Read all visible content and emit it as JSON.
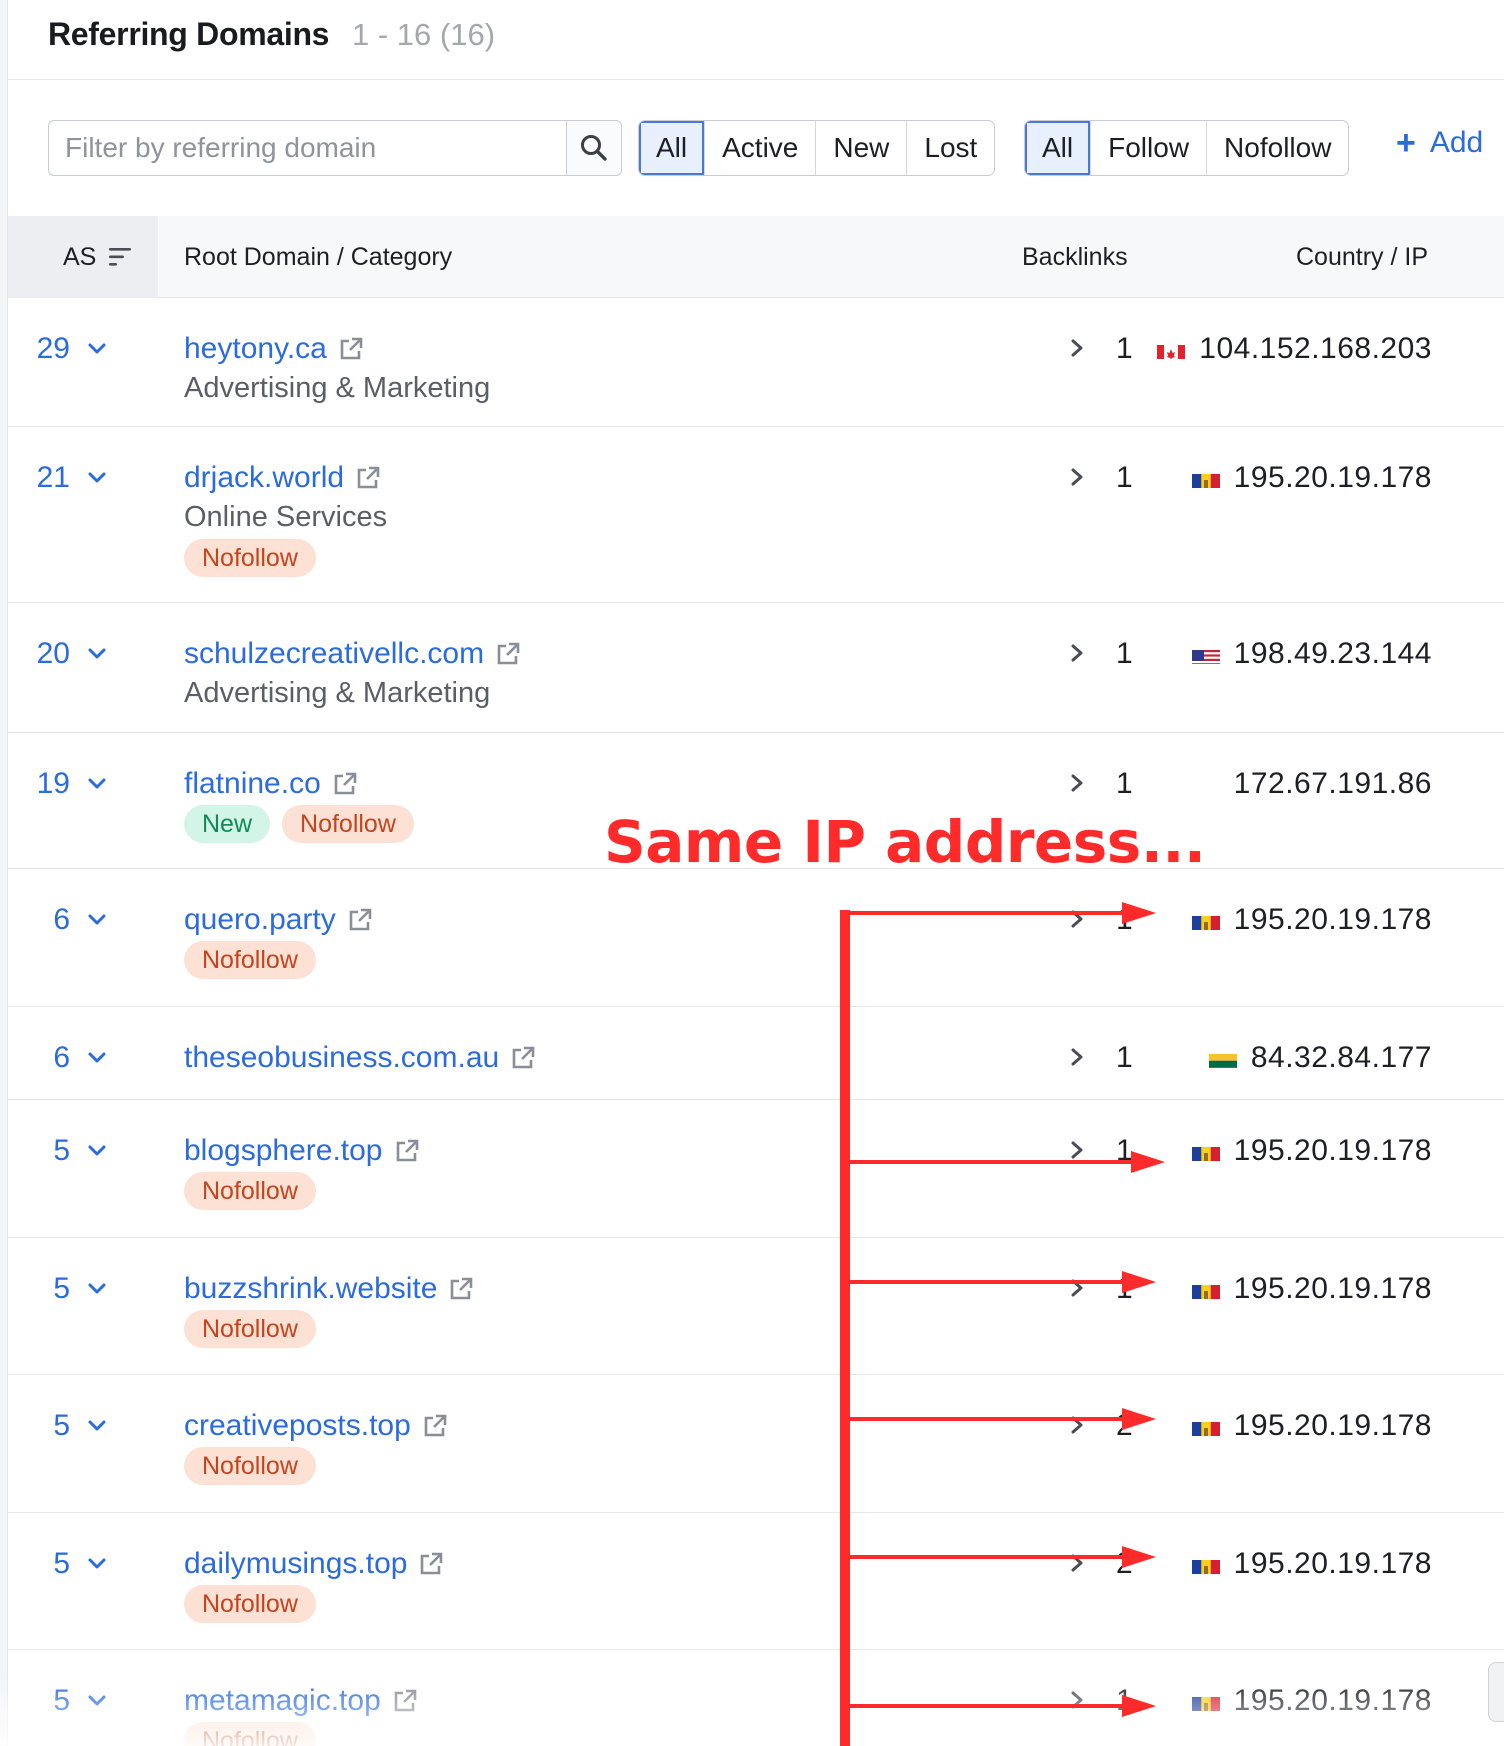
{
  "header": {
    "title": "Referring Domains",
    "count": "1 - 16 (16)"
  },
  "filters": {
    "search_placeholder": "Filter by referring domain",
    "status_options": [
      "All",
      "Active",
      "New",
      "Lost"
    ],
    "status_selected": "All",
    "link_type_options": [
      "All",
      "Follow",
      "Nofollow"
    ],
    "link_type_selected": "All",
    "add_label": "Add"
  },
  "table": {
    "columns": {
      "as": "AS",
      "domain": "Root Domain / Category",
      "backlinks": "Backlinks",
      "country": "Country / IP"
    },
    "rows": [
      {
        "as": "29",
        "domain": "heytony.ca",
        "category": "Advertising & Marketing",
        "badges": [],
        "backlinks": "1",
        "flag": "CA",
        "ip": "104.152.168.203"
      },
      {
        "as": "21",
        "domain": "drjack.world",
        "category": "Online Services",
        "badges": [
          "Nofollow"
        ],
        "backlinks": "1",
        "flag": "MD",
        "ip": "195.20.19.178"
      },
      {
        "as": "20",
        "domain": "schulzecreativellc.com",
        "category": "Advertising & Marketing",
        "badges": [],
        "backlinks": "1",
        "flag": "US",
        "ip": "198.49.23.144"
      },
      {
        "as": "19",
        "domain": "flatnine.co",
        "category": "",
        "badges": [
          "New",
          "Nofollow"
        ],
        "backlinks": "1",
        "flag": "",
        "ip": "172.67.191.86"
      },
      {
        "as": "6",
        "domain": "quero.party",
        "category": "",
        "badges": [
          "Nofollow"
        ],
        "backlinks": "1",
        "flag": "MD",
        "ip": "195.20.19.178"
      },
      {
        "as": "6",
        "domain": "theseobusiness.com.au",
        "category": "",
        "badges": [],
        "backlinks": "1",
        "flag": "LT",
        "ip": "84.32.84.177"
      },
      {
        "as": "5",
        "domain": "blogsphere.top",
        "category": "",
        "badges": [
          "Nofollow"
        ],
        "backlinks": "1",
        "flag": "MD",
        "ip": "195.20.19.178"
      },
      {
        "as": "5",
        "domain": "buzzshrink.website",
        "category": "",
        "badges": [
          "Nofollow"
        ],
        "backlinks": "1",
        "flag": "MD",
        "ip": "195.20.19.178"
      },
      {
        "as": "5",
        "domain": "creativeposts.top",
        "category": "",
        "badges": [
          "Nofollow"
        ],
        "backlinks": "2",
        "flag": "MD",
        "ip": "195.20.19.178"
      },
      {
        "as": "5",
        "domain": "dailymusings.top",
        "category": "",
        "badges": [
          "Nofollow"
        ],
        "backlinks": "2",
        "flag": "MD",
        "ip": "195.20.19.178"
      },
      {
        "as": "5",
        "domain": "metamagic.top",
        "category": "",
        "badges": [
          "Nofollow"
        ],
        "backlinks": "1",
        "flag": "MD",
        "ip": "195.20.19.178"
      }
    ]
  },
  "annotation": {
    "text": "Same IP address...",
    "color": "#ff2a2a"
  },
  "colors": {
    "link": "#2b6be0",
    "nofollow_bg": "#fde1d4",
    "nofollow_text": "#c4441e",
    "new_bg": "#d3f5e7",
    "new_text": "#118a5a",
    "active_segment": "#e9f0fd"
  }
}
